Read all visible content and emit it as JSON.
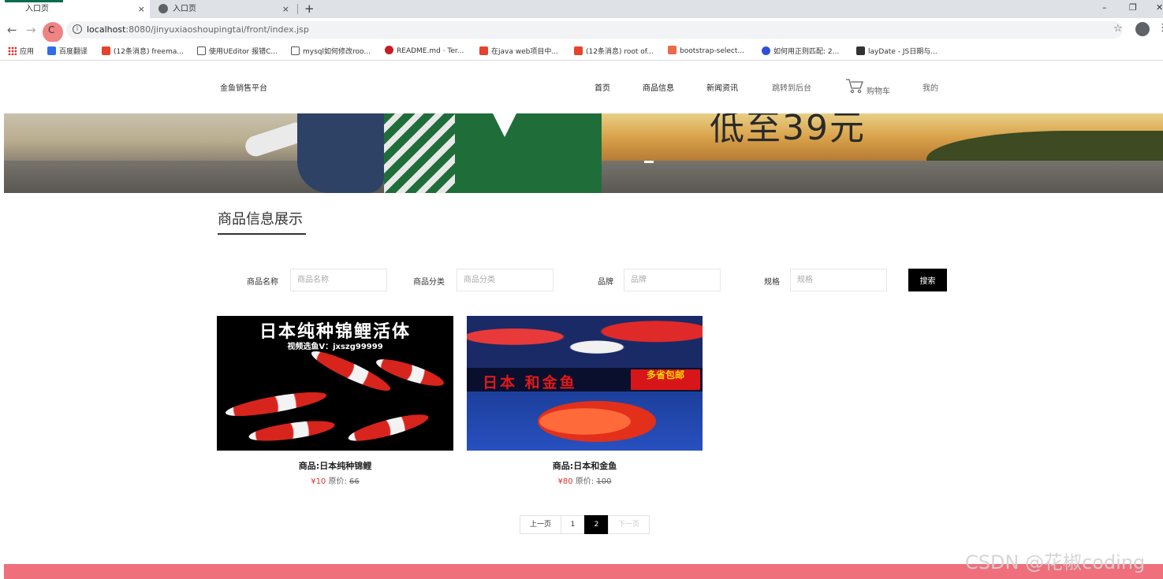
{
  "browser": {
    "tabs": [
      {
        "title": "入口页",
        "active": true
      },
      {
        "title": "入口页",
        "active": false
      }
    ],
    "new_tab": "+",
    "tab_close": "×",
    "window_controls": {
      "minimize": "–",
      "restore": "❐",
      "close": "✕"
    },
    "nav": {
      "back": "←",
      "forward": "→",
      "reload": "C"
    },
    "url_host": "localhost",
    "url_path": ":8080/jinyuxiaoshoupingtai/front/index.jsp",
    "info": "i",
    "star": "☆",
    "menu": "⋮",
    "bookmarks": [
      {
        "label": "应用",
        "icon": "apps-grid-icon",
        "color": "#d93025"
      },
      {
        "label": "百度翻译",
        "icon": "baidu-translate-icon",
        "color": "#2f6ee8"
      },
      {
        "label": "(12条消息) freema...",
        "icon": "csdn-icon",
        "color": "#e5432b"
      },
      {
        "label": "使用UEditor 报错C...",
        "icon": "segmentfault-icon",
        "color": "#555555"
      },
      {
        "label": "mysql如何修改roo...",
        "icon": "segmentfault-icon",
        "color": "#555555"
      },
      {
        "label": "README.md · Ter...",
        "icon": "gitee-icon",
        "color": "#c71d23"
      },
      {
        "label": "在java web项目中...",
        "icon": "csdn-icon",
        "color": "#e5432b"
      },
      {
        "label": "(12条消息) root of...",
        "icon": "csdn-icon",
        "color": "#e5432b"
      },
      {
        "label": "bootstrap-select...",
        "icon": "bootstrap-icon",
        "color": "#ea6a4a"
      },
      {
        "label": "如何用正则匹配: 2...",
        "icon": "baidu-paw-icon",
        "color": "#2f4fd8"
      },
      {
        "label": "layDate - JS日期与...",
        "icon": "layui-icon",
        "color": "#333333"
      }
    ]
  },
  "header": {
    "brand": "金鱼销售平台",
    "menu": [
      {
        "label": "首页"
      },
      {
        "label": "商品信息"
      },
      {
        "label": "新闻资讯"
      },
      {
        "label": "跳转到后台"
      },
      {
        "label": "购物车"
      },
      {
        "label": "我的"
      }
    ]
  },
  "banner": {
    "text": "低至39元"
  },
  "section": {
    "title": "商品信息展示"
  },
  "search": {
    "fields": [
      {
        "label": "商品名称",
        "placeholder": "商品名称"
      },
      {
        "label": "商品分类",
        "placeholder": "商品分类"
      },
      {
        "label": "品牌",
        "placeholder": "品牌"
      },
      {
        "label": "规格",
        "placeholder": "规格"
      }
    ],
    "button": "搜索"
  },
  "products": [
    {
      "name": "商品:日本纯种锦鲤",
      "price": "¥10",
      "orig_label": "原价:",
      "orig_price": "66",
      "image_title": "日本纯种锦鲤活体",
      "image_sub": "视频选鱼V：jxszg99999"
    },
    {
      "name": "商品:日本和金鱼",
      "price": "¥80",
      "orig_label": "原价:",
      "orig_price": "100",
      "image_title": "日本 和金鱼",
      "image_promo": "多省包邮"
    }
  ],
  "pagination": {
    "prev": "上一页",
    "pages": [
      "1",
      "2"
    ],
    "current": "2",
    "next": "下一页"
  },
  "watermark": "CSDN @花椒coding",
  "colors": {
    "price": "#e0322f",
    "footer": "#f06f7c",
    "search_button": "#000000"
  }
}
